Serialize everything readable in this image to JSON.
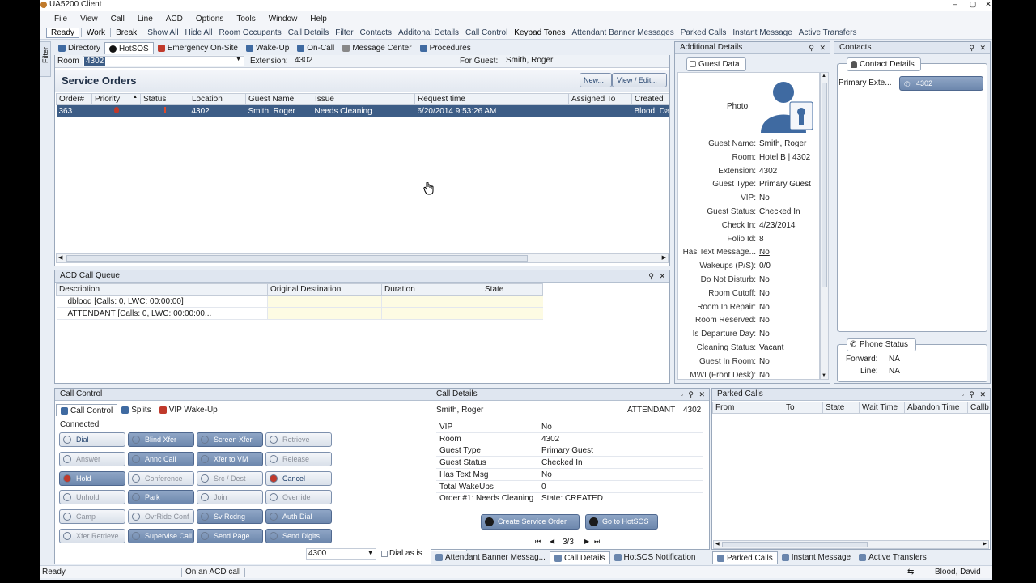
{
  "window": {
    "title": "UA5200 Client"
  },
  "menu": [
    "File",
    "View",
    "Call",
    "Line",
    "ACD",
    "Options",
    "Tools",
    "Window",
    "Help"
  ],
  "toolbar": {
    "primary": [
      "Ready",
      "Work",
      "Break"
    ],
    "items": [
      "Show All",
      "Hide All",
      "Room Occupants",
      "Call Details",
      "Filter",
      "Contacts",
      "Additonal Details",
      "Call Control",
      "Keypad Tones",
      "Attendant Banner Messages",
      "Parked Calls",
      "Instant Message",
      "Active Transfers"
    ]
  },
  "sidebar": {
    "label": "Filter"
  },
  "main_tabs": [
    "Directory",
    "HotSOS",
    "Emergency On-Site",
    "Wake-Up",
    "On-Call",
    "Message Center",
    "Procedures"
  ],
  "room_bar": {
    "room_label": "Room",
    "room_value": "4302",
    "ext_label": "Extension:",
    "ext_value": "4302",
    "guest_label": "For Guest:",
    "guest_value": "Smith, Roger"
  },
  "service_orders": {
    "title": "Service Orders",
    "new_label": "New...",
    "view_label": "View / Edit...",
    "columns": [
      "Order#",
      "Priority",
      "Status",
      "Location",
      "Guest Name",
      "Issue",
      "Request time",
      "Assigned To",
      "Created"
    ],
    "rows": [
      [
        "363",
        "",
        "",
        "4302",
        "Smith, Roger",
        "Needs Cleaning",
        "6/20/2014 9:53:26 AM",
        "",
        "Blood, Da"
      ]
    ]
  },
  "acd_queue": {
    "title": "ACD Call Queue",
    "columns": [
      "Description",
      "Original Destination",
      "Duration",
      "State"
    ],
    "rows": [
      [
        "dblood [Calls: 0, LWC: 00:00:00]",
        "",
        "",
        ""
      ],
      [
        "ATTENDANT [Calls: 0, LWC: 00:00:00...",
        "",
        "",
        ""
      ]
    ]
  },
  "additional_details": {
    "title": "Additional Details",
    "tab": "Guest Data",
    "photo_label": "Photo:",
    "fields": [
      [
        "Guest Name:",
        "Smith, Roger"
      ],
      [
        "Room:",
        "Hotel B | 4302"
      ],
      [
        "Extension:",
        "4302"
      ],
      [
        "Guest Type:",
        "Primary Guest"
      ],
      [
        "VIP:",
        "No"
      ],
      [
        "Guest Status:",
        "Checked In"
      ],
      [
        "Check In:",
        "4/23/2014"
      ],
      [
        "Folio Id:",
        "8"
      ],
      [
        "Has Text Message...",
        "No"
      ],
      [
        "Wakeups (P/S):",
        "0/0"
      ],
      [
        "Do Not Disturb:",
        "No"
      ],
      [
        "Room Cutoff:",
        "No"
      ],
      [
        "Room In Repair:",
        "No"
      ],
      [
        "Room Reserved:",
        "No"
      ],
      [
        "Is Departure Day:",
        "No"
      ],
      [
        "Cleaning Status:",
        "Vacant"
      ],
      [
        "Guest In Room:",
        "No"
      ],
      [
        "MWI (Front Desk):",
        "No"
      ]
    ]
  },
  "contacts": {
    "title": "Contacts",
    "tab": "Contact Details",
    "primary_label": "Primary Exte...",
    "primary_value": "4302",
    "phone_status_label": "Phone Status",
    "forward_label": "Forward:",
    "forward_value": "NA",
    "line_label": "Line:",
    "line_value": "NA"
  },
  "call_control": {
    "title": "Call Control",
    "tabs": [
      "Call Control",
      "Splits",
      "VIP Wake-Up"
    ],
    "state": "Connected",
    "buttons": [
      [
        "Dial",
        "Blind Xfer",
        "Screen Xfer",
        "Retrieve"
      ],
      [
        "Answer",
        "Annc Call",
        "Xfer to VM",
        "Release"
      ],
      [
        "Hold",
        "Conference",
        "Src / Dest",
        "Cancel"
      ],
      [
        "Unhold",
        "Park",
        "Join",
        "Override"
      ],
      [
        "Camp",
        "OvrRide Conf",
        "Sv Rcdng",
        "Auth Dial"
      ],
      [
        "Xfer Retrieve",
        "Supervise Call",
        "Send Page",
        "Send Digits"
      ]
    ],
    "dial_value": "4300",
    "dial_as_is": "Dial as is"
  },
  "call_details": {
    "title": "Call Details",
    "caller": "Smith, Roger",
    "queue": "ATTENDANT",
    "ext": "4302",
    "rows": [
      [
        "VIP",
        "No"
      ],
      [
        "Room",
        "4302"
      ],
      [
        "Guest Type",
        "Primary Guest"
      ],
      [
        "Guest Status",
        "Checked In"
      ],
      [
        "Has Text Msg",
        "No"
      ],
      [
        "Total WakeUps",
        "0"
      ],
      [
        "Order #1: Needs Cleaning",
        "State: CREATED"
      ]
    ],
    "create_label": "Create Service Order",
    "goto_label": "Go to HotSOS",
    "pager": "3/3",
    "bottom_tabs": [
      "Attendant Banner Messag...",
      "Call Details",
      "HotSOS Notification"
    ]
  },
  "parked_calls": {
    "title": "Parked Calls",
    "columns": [
      "From",
      "To",
      "State",
      "Wait Time",
      "Abandon Time",
      "Callb"
    ],
    "bottom_tabs": [
      "Parked Calls",
      "Instant Message",
      "Active Transfers"
    ]
  },
  "status_bar": {
    "left": "Ready",
    "middle": "On an ACD call",
    "user": "Blood, David"
  }
}
